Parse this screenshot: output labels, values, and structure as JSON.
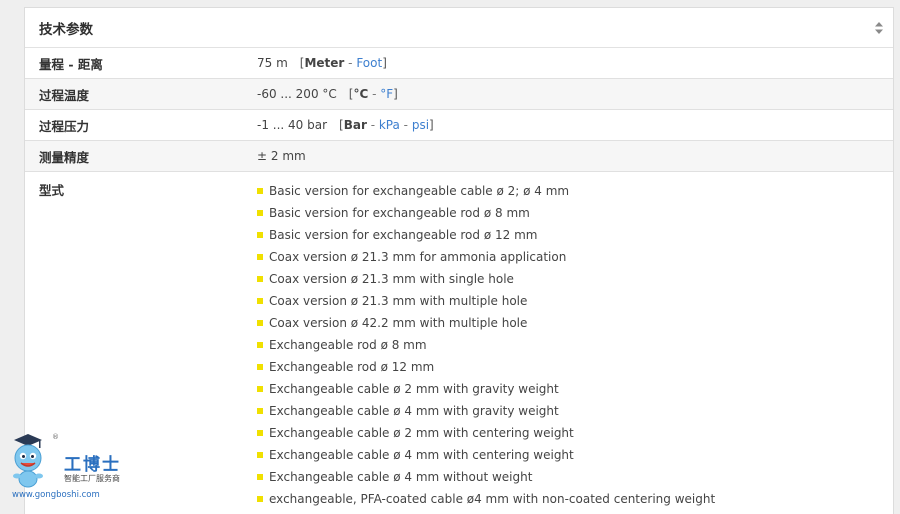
{
  "panel": {
    "title": "技术参数"
  },
  "rows": [
    {
      "label": "量程 - 距离",
      "value": "75 m",
      "unit_open": "[",
      "unit_active": "Meter",
      "unit_sep": " - ",
      "unit_link": "Foot",
      "unit_close": "]"
    },
    {
      "label": "过程温度",
      "value": "-60 ... 200 °C",
      "unit_open": "[",
      "unit_active": "°C",
      "unit_sep": " - ",
      "unit_link": "°F",
      "unit_close": "]"
    },
    {
      "label": "过程压力",
      "value": "-1 ... 40 bar",
      "unit_open": "[",
      "unit_active": "Bar",
      "unit_sep": " - ",
      "unit_link": "kPa",
      "unit_sep2": " - ",
      "unit_link2": "psi",
      "unit_close": "]"
    },
    {
      "label": "测量精度",
      "value": "± 2 mm"
    }
  ],
  "types": {
    "label": "型式",
    "items": [
      "Basic version for exchangeable cable ø 2; ø 4 mm",
      "Basic version for exchangeable rod ø 8 mm",
      "Basic version for exchangeable rod ø 12 mm",
      "Coax version ø 21.3 mm for ammonia application",
      "Coax version ø 21.3 mm with single hole",
      "Coax version ø 21.3 mm with multiple hole",
      "Coax version ø 42.2 mm with multiple hole",
      "Exchangeable rod ø 8 mm",
      "Exchangeable rod ø 12 mm",
      "Exchangeable cable ø 2 mm with gravity weight",
      "Exchangeable cable ø 4 mm with gravity weight",
      "Exchangeable cable ø 2 mm with centering weight",
      "Exchangeable cable ø 4 mm with centering weight",
      "Exchangeable cable ø 4 mm without weight",
      "exchangeable, PFA-coated cable ø4 mm with non-coated centering weight"
    ]
  },
  "watermark": {
    "name": "工博士",
    "tagline": "智能工厂服务商",
    "url": "www.gongboshi.com",
    "reg": "®"
  },
  "colors": {
    "bullet": "#f0e000",
    "link": "#3d7fcf",
    "brand": "#2a6fbf"
  }
}
